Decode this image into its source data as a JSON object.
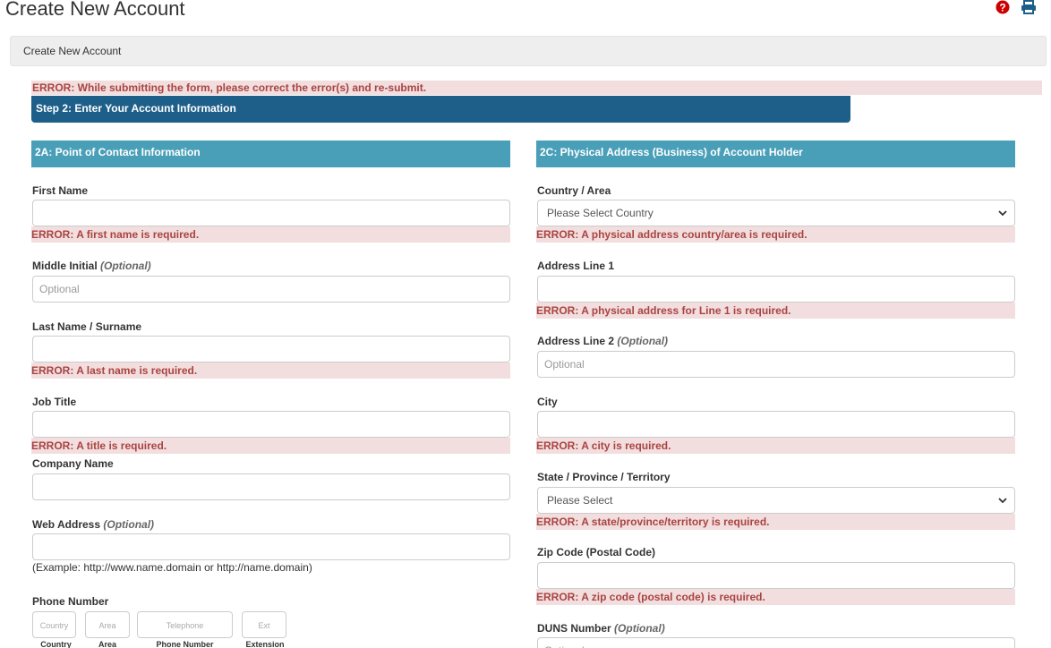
{
  "page": {
    "title": "Create New Account"
  },
  "breadcrumb": {
    "label": "Create New Account"
  },
  "form_error": "ERROR: While submitting the form, please correct the error(s) and re-submit.",
  "step": {
    "label": "Step 2: Enter Your Account Information"
  },
  "left": {
    "heading": "2A: Point of Contact Information",
    "first_name": {
      "label": "First Name",
      "error": "ERROR: A first name is required."
    },
    "middle_initial": {
      "label": "Middle Initial",
      "optional": "(Optional)",
      "placeholder": "Optional"
    },
    "last_name": {
      "label": "Last Name / Surname",
      "error": "ERROR: A last name is required."
    },
    "job_title": {
      "label": "Job Title",
      "error": "ERROR: A title is required."
    },
    "company": {
      "label": "Company Name"
    },
    "web": {
      "label": "Web Address",
      "optional": "(Optional)",
      "hint": "(Example: http://www.name.domain or http://name.domain)"
    },
    "phone": {
      "label": "Phone Number",
      "country_ph": "Country",
      "area_ph": "Area",
      "tel_ph": "Telephone",
      "ext_ph": "Ext",
      "country_lbl": "Country",
      "area_lbl": "Area",
      "tel_lbl": "Phone Number",
      "ext_lbl": "Extension"
    }
  },
  "right": {
    "heading": "2C: Physical Address (Business) of Account Holder",
    "country": {
      "label": "Country / Area",
      "selected": "Please Select Country",
      "error": "ERROR: A physical address country/area is required."
    },
    "addr1": {
      "label": "Address Line 1",
      "error": "ERROR: A physical address for Line 1 is required."
    },
    "addr2": {
      "label": "Address Line 2",
      "optional": "(Optional)",
      "placeholder": "Optional"
    },
    "city": {
      "label": "City",
      "error": "ERROR: A city is required."
    },
    "state": {
      "label": "State / Province / Territory",
      "selected": "Please Select",
      "error": "ERROR: A state/province/territory is required."
    },
    "zip": {
      "label": "Zip Code (Postal Code)",
      "error": "ERROR: A zip code (postal code) is required."
    },
    "duns": {
      "label": "DUNS Number",
      "optional": "(Optional)",
      "placeholder": "Optional"
    }
  },
  "icons": {
    "help": "help-icon",
    "print": "print-icon",
    "chevron": "chevron-down-icon"
  },
  "colors": {
    "error_bg": "#f2dede",
    "error_text": "#a94442",
    "step_bar": "#1e5f8a",
    "section_head": "#4a9fb8"
  }
}
